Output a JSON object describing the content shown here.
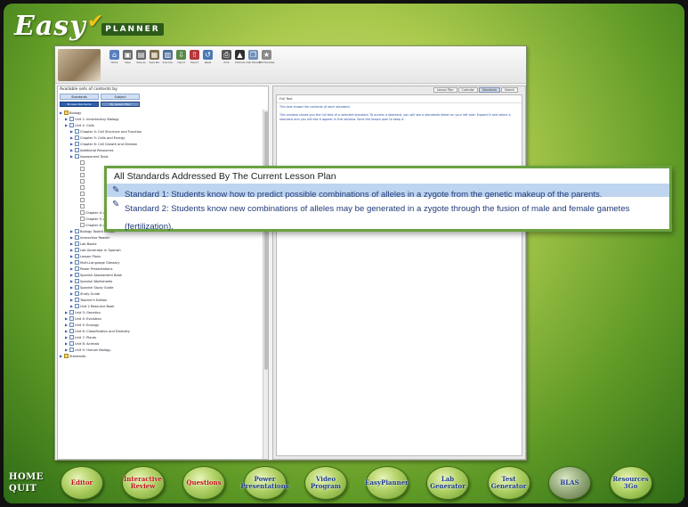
{
  "app": {
    "logo_text": "Easy",
    "logo_badge": "PLANNER"
  },
  "toolbar": {
    "buttons": [
      {
        "label": "Home",
        "icon": "home-icon",
        "color": "#5a7fbf"
      },
      {
        "label": "Save",
        "icon": "save-icon",
        "color": "#6b6b6b"
      },
      {
        "label": "Save As",
        "icon": "save-as-icon",
        "color": "#6b6b6b"
      },
      {
        "label": "Save Pac",
        "icon": "package-icon",
        "color": "#7d6b4a"
      },
      {
        "label": "Scan Doc",
        "icon": "scanner-icon",
        "color": "#4e6e9a"
      },
      {
        "label": "Import",
        "icon": "import-icon",
        "color": "#5a8a4a"
      },
      {
        "label": "Export",
        "icon": "export-icon",
        "color": "#b7373a"
      },
      {
        "label": "Reset",
        "icon": "reset-icon",
        "color": "#4a78b5"
      },
      {
        "label": "Print",
        "icon": "print-icon",
        "color": "#555555"
      },
      {
        "label": "Tutorials",
        "icon": "grad-cap-icon",
        "color": "#2f2f2f"
      },
      {
        "label": "User Manual",
        "icon": "manual-icon",
        "color": "#6f8fb7"
      },
      {
        "label": "Edit Favorites",
        "icon": "favorites-icon",
        "color": "#8a8a8a"
      }
    ]
  },
  "left_pane": {
    "header": "Available sets of contents by",
    "tabs": [
      "Standards",
      "Subject"
    ],
    "subtabs": [
      "Browse Standards",
      "My Lesson Plan"
    ],
    "tree": [
      {
        "level": 0,
        "type": "book",
        "label": "Biology"
      },
      {
        "level": 1,
        "type": "folder",
        "label": "Unit 1: Introductory Biology"
      },
      {
        "level": 1,
        "type": "folder",
        "label": "Unit 2: Cells"
      },
      {
        "level": 2,
        "type": "folder",
        "label": "Chapter 4: Cell Structure and Function"
      },
      {
        "level": 2,
        "type": "folder",
        "label": "Chapter 5: Cells and Energy"
      },
      {
        "level": 2,
        "type": "folder",
        "label": "Chapter 6: Cell Growth and Division"
      },
      {
        "level": 2,
        "type": "folder",
        "label": "Additional Resources"
      },
      {
        "level": 2,
        "type": "folder",
        "label": "Assessment Tools"
      },
      {
        "level": 3,
        "type": "doc",
        "label": ""
      },
      {
        "level": 3,
        "type": "doc",
        "label": ""
      },
      {
        "level": 3,
        "type": "doc",
        "label": ""
      },
      {
        "level": 3,
        "type": "doc",
        "label": ""
      },
      {
        "level": 3,
        "type": "doc",
        "label": ""
      },
      {
        "level": 3,
        "type": "doc",
        "label": ""
      },
      {
        "level": 3,
        "type": "doc",
        "label": ""
      },
      {
        "level": 3,
        "type": "doc",
        "label": ""
      },
      {
        "level": 3,
        "type": "doc",
        "label": "Chapter 4: Assessment Test"
      },
      {
        "level": 3,
        "type": "doc",
        "label": "Chapter 5: Assessment Test"
      },
      {
        "level": 3,
        "type": "doc",
        "label": "Chapter 6: Assessment Test Answers"
      },
      {
        "level": 2,
        "type": "folder",
        "label": "Biology Toolkit Reader"
      },
      {
        "level": 2,
        "type": "folder",
        "label": "Interactive Reader"
      },
      {
        "level": 2,
        "type": "folder",
        "label": "Lab Books"
      },
      {
        "level": 2,
        "type": "folder",
        "label": "Lab Generator in Spanish"
      },
      {
        "level": 2,
        "type": "folder",
        "label": "Lesson Plans"
      },
      {
        "level": 2,
        "type": "folder",
        "label": "Multi-Language Glossary"
      },
      {
        "level": 2,
        "type": "folder",
        "label": "Power Presentations"
      },
      {
        "level": 2,
        "type": "folder",
        "label": "Spanish Assessment Book"
      },
      {
        "level": 2,
        "type": "folder",
        "label": "Spanish Worksheets"
      },
      {
        "level": 2,
        "type": "folder",
        "label": "Spanish Study Guide"
      },
      {
        "level": 2,
        "type": "folder",
        "label": "Study Guide"
      },
      {
        "level": 2,
        "type": "folder",
        "label": "Teacher's Edition"
      },
      {
        "level": 2,
        "type": "folder",
        "label": "Unit 2 Resource Book"
      },
      {
        "level": 1,
        "type": "folder",
        "label": "Unit 3: Genetics"
      },
      {
        "level": 1,
        "type": "folder",
        "label": "Unit 4: Evolution"
      },
      {
        "level": 1,
        "type": "folder",
        "label": "Unit 5: Ecology"
      },
      {
        "level": 1,
        "type": "folder",
        "label": "Unit 6: Classification and Diversity"
      },
      {
        "level": 1,
        "type": "folder",
        "label": "Unit 7: Plants"
      },
      {
        "level": 1,
        "type": "folder",
        "label": "Unit 8: Animals"
      },
      {
        "level": 1,
        "type": "folder",
        "label": "Unit 9: Human Biology"
      },
      {
        "level": 0,
        "type": "book",
        "label": "Standards"
      }
    ]
  },
  "right_pane": {
    "tabs": [
      "Lesson Plan",
      "Calendar",
      "Standards",
      "Search"
    ],
    "active_tab": 2,
    "header": "Full Text",
    "text_1": "This text shows the contents of each standard.",
    "text_2": "This window shows you the full text of a selected standard. To access a standard, you will see a standards folder on your left side. Expand it and select a standard and you will see it appear in this window. Save the lesson plan to keep it."
  },
  "popup": {
    "title": "All Standards Addressed By The Current Lesson Plan",
    "standard_1": "Standard 1: Students know how to predict possible combinations of alleles in a zygote from the genetic makeup of the parents.",
    "standard_2": "Standard 2: Students know new combinations of alleles may be generated in a zygote through the fusion of male and female gametes (fertilization).",
    "selected_color": "#bed4ef"
  },
  "navbar": {
    "home_label": "HOME",
    "quit_label": "QUIT",
    "buttons": [
      {
        "label": "Editor",
        "style": "red",
        "icon": "editor-button"
      },
      {
        "label": "Interactive Review",
        "style": "red",
        "icon": "interactive-review-button"
      },
      {
        "label": "Questions",
        "style": "red",
        "icon": "questions-button"
      },
      {
        "label": "Power Presentations",
        "style": "blue",
        "icon": "power-presentations-button"
      },
      {
        "label": "Video Program",
        "style": "blue",
        "icon": "video-program-button"
      },
      {
        "label": "EasyPlanner",
        "style": "blue",
        "icon": "easyplanner-button"
      },
      {
        "label": "Lab Generator",
        "style": "blue",
        "icon": "lab-generator-button"
      },
      {
        "label": "Test Generator",
        "style": "blue",
        "icon": "test-generator-button"
      },
      {
        "label": "BLAS",
        "style": "dim",
        "icon": "blas-button"
      },
      {
        "label": "Resources 3Go",
        "style": "blue",
        "icon": "resources-button"
      }
    ]
  }
}
